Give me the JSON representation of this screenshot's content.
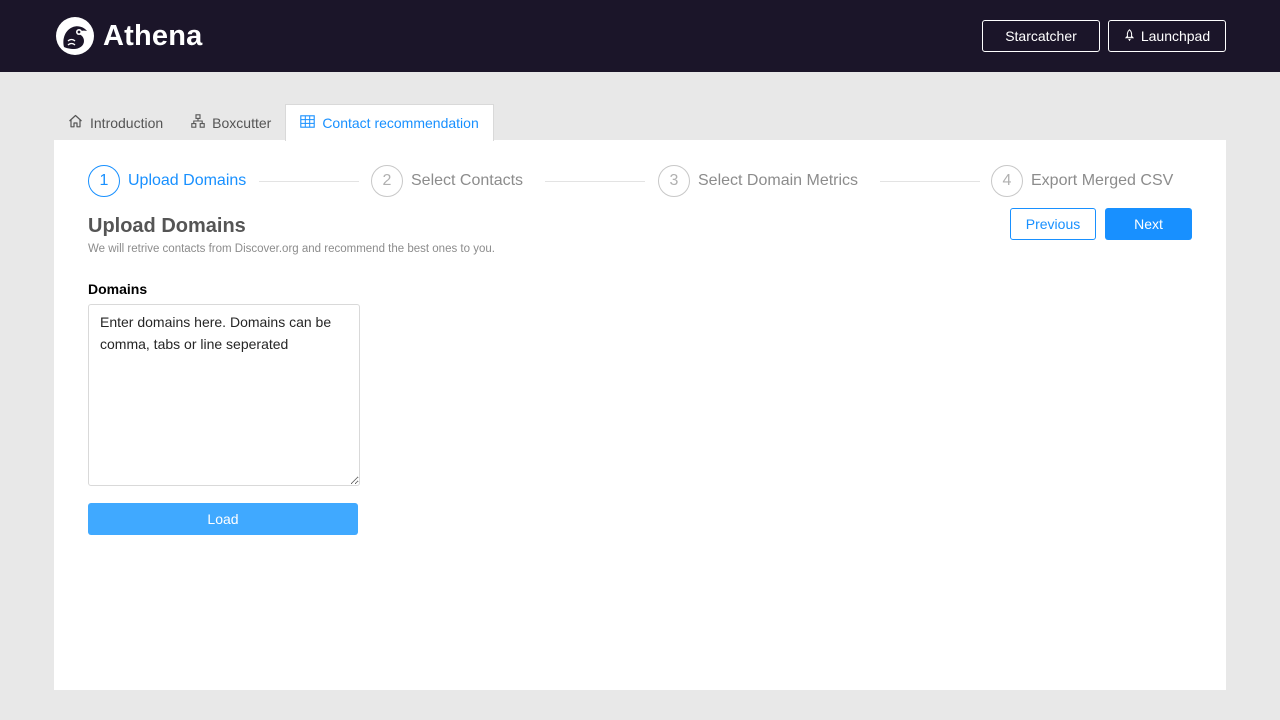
{
  "header": {
    "brand_name": "Athena",
    "logo_icon": "owl-logo-icon",
    "buttons": {
      "starcatcher": "Starcatcher",
      "launchpad": "Launchpad",
      "launchpad_icon": "rocket-icon"
    }
  },
  "tabs": [
    {
      "label": "Introduction",
      "icon": "home-icon",
      "active": false
    },
    {
      "label": "Boxcutter",
      "icon": "hierarchy-icon",
      "active": false
    },
    {
      "label": "Contact recommendation",
      "icon": "table-icon",
      "active": true
    }
  ],
  "steps": [
    {
      "number": "1",
      "title": "Upload Domains",
      "status": "active"
    },
    {
      "number": "2",
      "title": "Select Contacts",
      "status": "wait"
    },
    {
      "number": "3",
      "title": "Select Domain Metrics",
      "status": "wait"
    },
    {
      "number": "4",
      "title": "Export Merged CSV",
      "status": "wait"
    }
  ],
  "section": {
    "title": "Upload Domains",
    "description": "We will retrive contacts from Discover.org and recommend the best ones to you."
  },
  "navigation": {
    "previous_label": "Previous",
    "next_label": "Next"
  },
  "form": {
    "domains_label": "Domains",
    "domains_placeholder": "Enter domains here. Domains can be comma, tabs or line seperated",
    "domains_value": "",
    "load_label": "Load"
  },
  "colors": {
    "header_bg": "#1b1529",
    "primary": "#1890ff",
    "load_button": "#40a9ff",
    "page_bg": "#e8e8e8"
  }
}
